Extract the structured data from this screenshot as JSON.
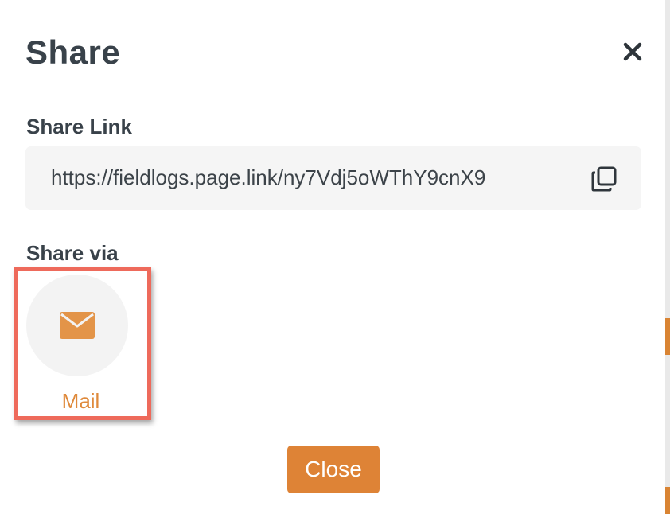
{
  "modal": {
    "title": "Share",
    "close_icon": "close-x-icon"
  },
  "share_link": {
    "label": "Share Link",
    "url": "https://fieldlogs.page.link/ny7Vdj5oWThY9cnX9",
    "copy_icon": "copy-icon"
  },
  "share_via": {
    "label": "Share via",
    "options": [
      {
        "label": "Mail",
        "icon": "envelope-icon"
      }
    ]
  },
  "footer": {
    "close_label": "Close"
  },
  "colors": {
    "accent": "#de8336",
    "mail_label": "#df8a3c",
    "highlight_border": "#ee6a5b",
    "text_dark": "#39424a",
    "link_box_bg": "#f5f5f5",
    "icon_circle_bg": "#f3f3f3"
  }
}
